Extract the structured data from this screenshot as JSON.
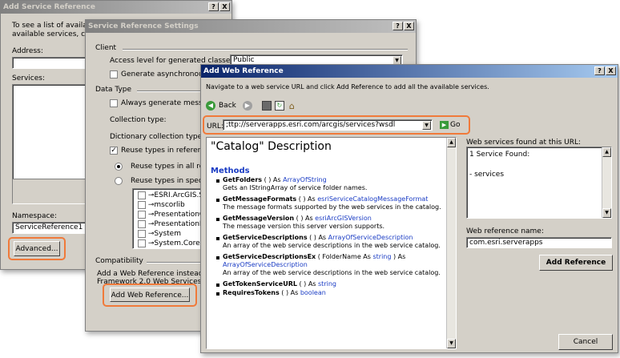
{
  "dialog1": {
    "title": "Add Service Reference",
    "intro_line1": "To see a list of available s",
    "intro_line2": "available services, click D",
    "address_label": "Address:",
    "services_label": "Services:",
    "namespace_label": "Namespace:",
    "namespace_value": "ServiceReference1",
    "advanced_button": "Advanced...",
    "help_btn": "?",
    "close_btn": "X"
  },
  "dialog2": {
    "title": "Service Reference Settings",
    "client_section": "Client",
    "access_level_label": "Access level for generated classes:",
    "access_level_value": "Public",
    "async_label": "Generate asynchronous ope",
    "data_type_section": "Data Type",
    "always_generate_label": "Always generate message c",
    "collection_type_label": "Collection type:",
    "dictionary_type_label": "Dictionary collection type:",
    "reuse_types_label": "Reuse types in referenced a",
    "reuse_all_label": "Reuse types in all refer",
    "reuse_specified_label": "Reuse types in specified",
    "assemblies": [
      "ESRI.ArcGIS.S",
      "mscorlib",
      "PresentationC",
      "PresentationF",
      "System",
      "System.Core"
    ],
    "compat_section": "Compatibility",
    "compat_line1": "Add a Web Reference instead o",
    "compat_line2": "Framework 2.0 Web Services te",
    "add_web_ref_button": "Add Web Reference...",
    "help_btn": "?",
    "close_btn": "X"
  },
  "dialog3": {
    "title": "Add Web Reference",
    "instruction": "Navigate to a web service URL and click Add Reference to add all the available services.",
    "back_label": "Back",
    "url_label": "URL:",
    "url_value": ";ttp://serverapps.esri.com/arcgis/services?wsdl",
    "go_label": "Go",
    "catalog_heading": "\"Catalog\" Description",
    "methods_heading": "Methods",
    "methods": [
      {
        "name": "GetFolders",
        "sig": " ( ) As ",
        "ret": "ArrayOfString",
        "desc": "Gets an IStringArray of service folder names."
      },
      {
        "name": "GetMessageFormats",
        "sig": " ( ) As ",
        "ret": "esriServiceCatalogMessageFormat",
        "desc": "The message formats supported by the web services in the catalog."
      },
      {
        "name": "GetMessageVersion",
        "sig": " ( ) As ",
        "ret": "esriArcGISVersion",
        "desc": "The message version this server version supports."
      },
      {
        "name": "GetServiceDescriptions",
        "sig": " ( ) As ",
        "ret": "ArrayOfServiceDescription",
        "desc": "An array of the web service descriptions in the web service catalog."
      },
      {
        "name": "GetServiceDescriptionsEx",
        "sig": " ( FolderName As ",
        "ret": "string",
        "sig2": " ) As",
        "ret2": "ArrayOfServiceDescription",
        "desc": "An array of the web service descriptions in the web service catalog."
      },
      {
        "name": "GetTokenServiceURL",
        "sig": " ( ) As ",
        "ret": "string",
        "desc": ""
      },
      {
        "name": "RequiresTokens",
        "sig": " ( ) As ",
        "ret": "boolean",
        "desc": ""
      }
    ],
    "found_label": "Web services found at this URL:",
    "found_count": "1 Service Found:",
    "found_item": "- services",
    "web_ref_name_label": "Web reference name:",
    "web_ref_name_value": "com.esri.serverapps",
    "add_reference_button": "Add Reference",
    "cancel_button": "Cancel",
    "help_btn": "?",
    "close_btn": "X"
  },
  "colors": {
    "highlight": "#f07a3a",
    "link": "#1a3cc4",
    "titlebar_active": "#0a246a"
  }
}
